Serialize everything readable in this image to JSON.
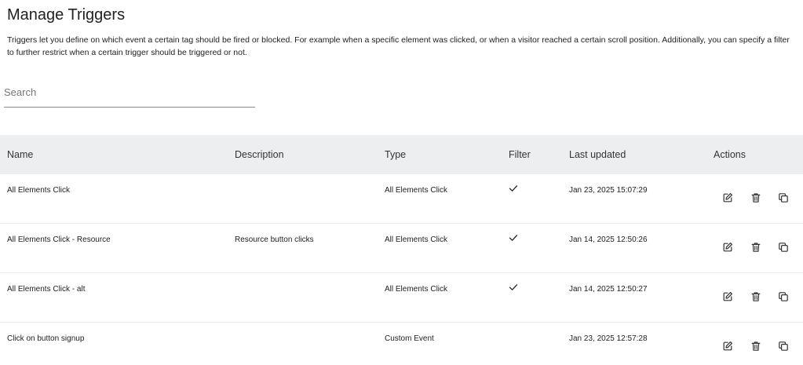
{
  "page": {
    "title": "Manage Triggers",
    "description": "Triggers let you define on which event a certain tag should be fired or blocked. For example when a specific element was clicked, or when a visitor reached a certain scroll position. Additionally, you can specify a filter to further restrict when a certain trigger should be triggered or not."
  },
  "search": {
    "placeholder": "Search",
    "value": ""
  },
  "table": {
    "headers": {
      "name": "Name",
      "description": "Description",
      "type": "Type",
      "filter": "Filter",
      "last_updated": "Last updated",
      "actions": "Actions"
    },
    "rows": [
      {
        "name": "All Elements Click",
        "description": "",
        "type": "All Elements Click",
        "filter": true,
        "last_updated": "Jan 23, 2025 15:07:29"
      },
      {
        "name": "All Elements Click - Resource",
        "description": "Resource button clicks",
        "type": "All Elements Click",
        "filter": true,
        "last_updated": "Jan 14, 2025 12:50:26"
      },
      {
        "name": "All Elements Click - alt",
        "description": "",
        "type": "All Elements Click",
        "filter": true,
        "last_updated": "Jan 14, 2025 12:50:27"
      },
      {
        "name": "Click on button signup",
        "description": "",
        "type": "Custom Event",
        "filter": false,
        "last_updated": "Jan 23, 2025 12:57:28"
      }
    ],
    "row_icons": {
      "filter": "checkmark-icon",
      "edit": "edit-icon",
      "delete": "trash-icon",
      "copy": "copy-icon"
    }
  }
}
